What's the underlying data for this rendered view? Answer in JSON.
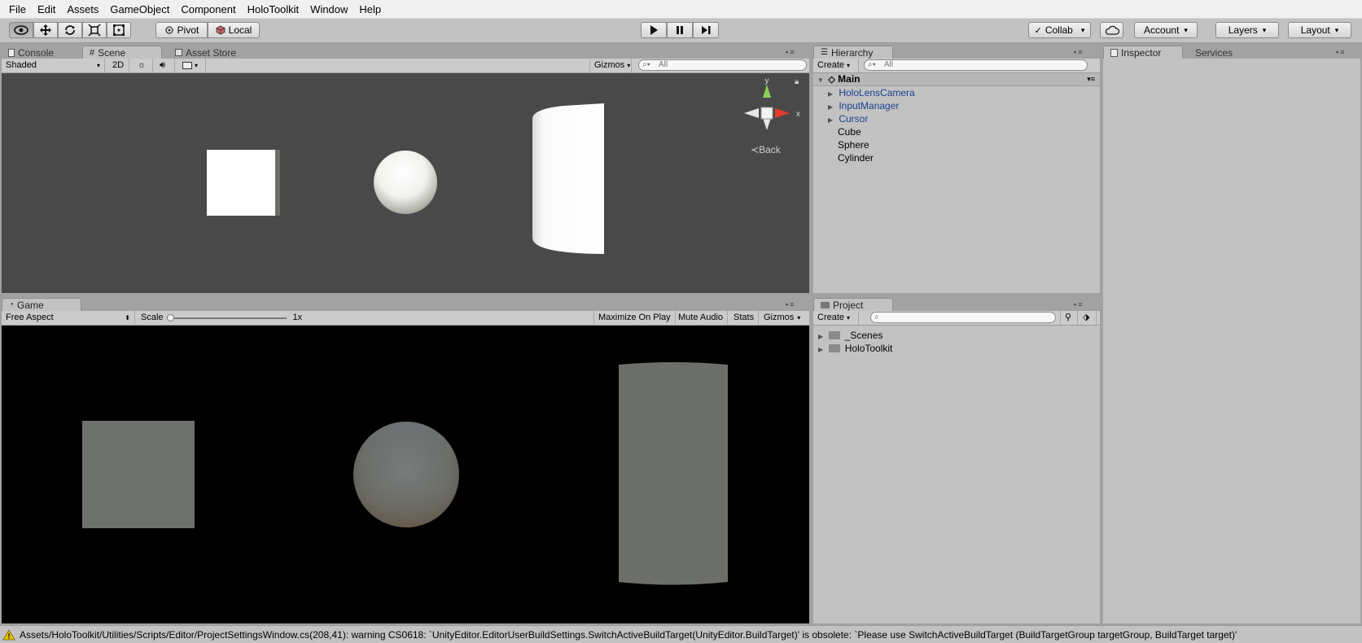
{
  "menu": [
    "File",
    "Edit",
    "Assets",
    "GameObject",
    "Component",
    "HoloToolkit",
    "Window",
    "Help"
  ],
  "toolbar": {
    "pivot_label": "Pivot",
    "local_label": "Local",
    "collab_label": "Collab",
    "account_label": "Account",
    "layers_label": "Layers",
    "layout_label": "Layout"
  },
  "scene_panel": {
    "tabs": [
      "Console",
      "Scene",
      "Asset Store"
    ],
    "shading_mode": "Shaded",
    "mode_2d": "2D",
    "gizmos_label": "Gizmos",
    "search_placeholder": "All",
    "back_label": "Back",
    "axis_y": "y",
    "axis_x": "x",
    "background_color": "#494949"
  },
  "game_panel": {
    "tab": "Game",
    "aspect": "Free Aspect",
    "scale_label": "Scale",
    "scale_value": "1x",
    "maximize_label": "Maximize On Play",
    "mute_label": "Mute Audio",
    "stats_label": "Stats",
    "gizmos_label": "Gizmos",
    "background_color": "#000000"
  },
  "hierarchy": {
    "tab": "Hierarchy",
    "create_label": "Create",
    "search_placeholder": "All",
    "scene_name": "Main",
    "items": [
      {
        "label": "HoloLensCamera",
        "expandable": true,
        "prefab": true
      },
      {
        "label": "InputManager",
        "expandable": true,
        "prefab": true
      },
      {
        "label": "Cursor",
        "expandable": true,
        "prefab": true
      },
      {
        "label": "Cube",
        "expandable": false,
        "prefab": false
      },
      {
        "label": "Sphere",
        "expandable": false,
        "prefab": false
      },
      {
        "label": "Cylinder",
        "expandable": false,
        "prefab": false
      }
    ]
  },
  "project": {
    "tab": "Project",
    "create_label": "Create",
    "folders": [
      "_Scenes",
      "HoloToolkit"
    ]
  },
  "inspector": {
    "tabs": [
      "Inspector",
      "Services"
    ]
  },
  "status_bar": {
    "message": "Assets/HoloToolkit/Utilities/Scripts/Editor/ProjectSettingsWindow.cs(208,41): warning CS0618: `UnityEditor.EditorUserBuildSettings.SwitchActiveBuildTarget(UnityEditor.BuildTarget)' is obsolete: `Please use SwitchActiveBuildTarget (BuildTargetGroup targetGroup, BuildTarget target)'"
  },
  "colors": {
    "prefab_text": "#1b3f8f",
    "panel_bg": "#c2c2c2",
    "warning": "#e8c000"
  }
}
